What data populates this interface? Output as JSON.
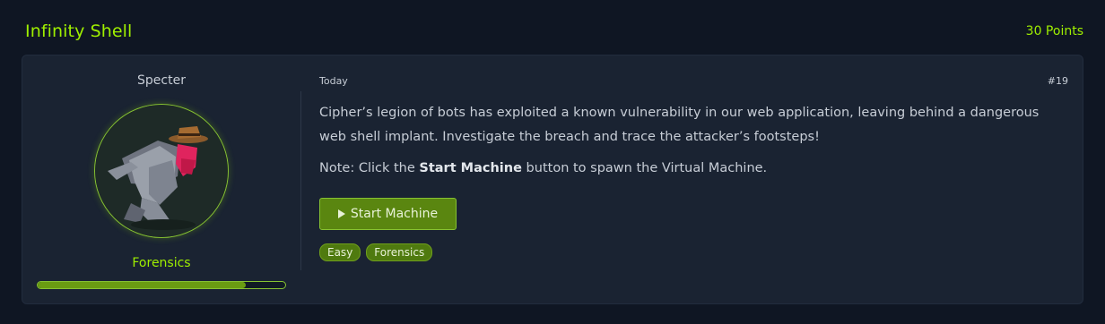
{
  "header": {
    "title": "Infinity Shell",
    "points": "30 Points"
  },
  "author": {
    "name": "Specter",
    "category": "Forensics",
    "progress_percent": 84
  },
  "challenge": {
    "date": "Today",
    "number": "#19",
    "description": "Cipher’s legion of bots has exploited a known vulnerability in our web application, leaving behind a dangerous web shell implant. Investigate the breach and trace the attacker’s footsteps!",
    "note_prefix": "Note: Click the ",
    "note_bold": "Start Machine",
    "note_suffix": " button to spawn the Virtual Machine.",
    "start_button": "Start Machine",
    "tags": [
      "Easy",
      "Forensics"
    ]
  },
  "colors": {
    "accent": "#9fef00",
    "background": "#0f1623",
    "card": "#1a2332",
    "button": "#5a8610"
  },
  "icons": {
    "play": "play-icon",
    "avatar": "hooded-figure-avatar"
  }
}
